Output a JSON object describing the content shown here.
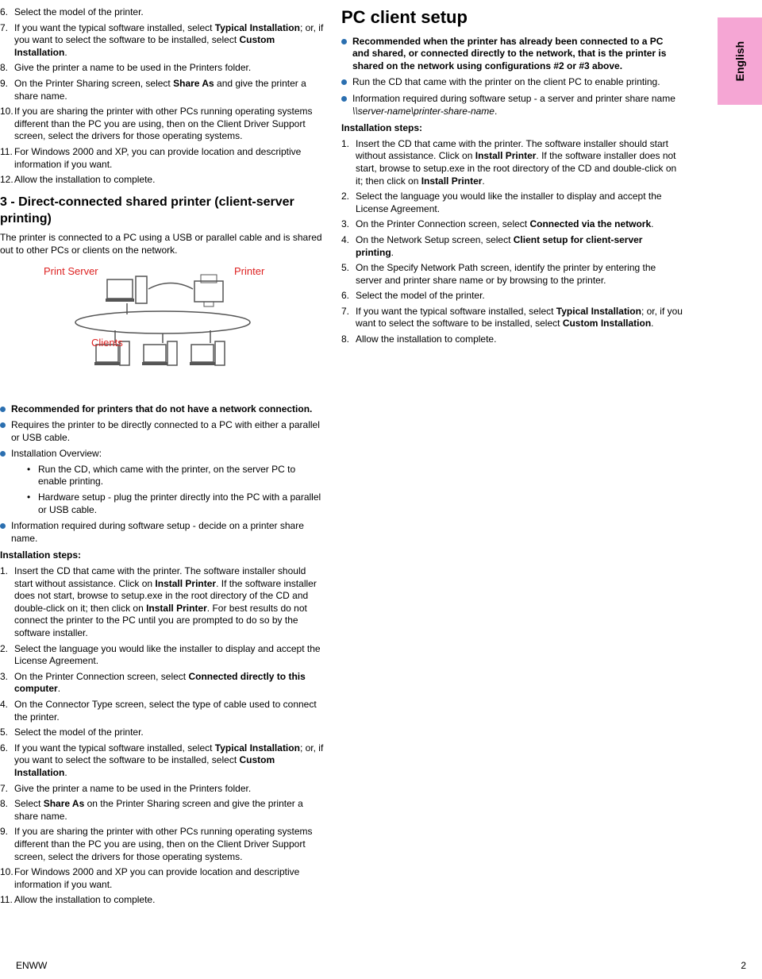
{
  "sideTab": "English",
  "leftTopList": {
    "start": 6,
    "items": [
      "Select the model of the printer.",
      "If you want the typical software installed, select <b>Typical Installation</b>; or, if you want to select the software to be installed, select <b>Custom Installation</b>.",
      "Give the printer a name to be used in the Printers folder.",
      "On the Printer Sharing screen, select <b>Share As</b> and give the printer a share name.",
      "If you are sharing the printer with other PCs running operating systems different than the PC you are using, then on the Client Driver Support screen, select the drivers for those operating systems.",
      "For Windows 2000 and XP, you can provide location and descriptive information if you want.",
      "Allow the installation to complete."
    ]
  },
  "section3": {
    "heading": "3 - Direct-connected shared printer (client-server printing)",
    "intro": "The printer is connected to a PC using a USB or parallel cable and is shared out to other PCs or clients on the network.",
    "diagram": {
      "printServer": "Print Server",
      "printer": "Printer",
      "clients": "Clients"
    },
    "bullets": [
      "<b>Recommended for printers that do not have a network connection.</b>",
      "Requires the printer to be directly connected to a PC with either a parallel or USB cable.",
      "Installation Overview:",
      "Information required during software setup - decide on a printer share name."
    ],
    "overviewSub": [
      "Run the CD, which came with the printer, on the server PC to enable printing.",
      "Hardware setup - plug the printer directly into the PC with a parallel or USB cable."
    ],
    "installLabel": "Installation steps:",
    "installSteps": [
      "Insert the CD that came with the printer. The software installer should start without assistance. Click on <b>Install Printer</b>. If the software installer does not start, browse to setup.exe in the root directory of the CD and double-click on it; then click on <b>Install Printer</b>. For best results do not connect the printer to the PC until you are prompted to do so by the software installer.",
      "Select the language you would like the installer to display and accept the License Agreement.",
      "On the Printer Connection screen, select <b>Connected directly to this computer</b>.",
      "On the Connector Type screen, select the type of cable used to connect the printer.",
      "Select the model of the printer.",
      "If you want the typical software installed, select <b>Typical Installation</b>; or, if you want to select the software to be installed, select <b>Custom Installation</b>.",
      "Give the printer a name to be used in the Printers folder.",
      "Select <b>Share As</b> on the Printer Sharing screen and give the printer a share name.",
      "If you are sharing the printer with other PCs running operating systems different than the PC you are using, then on the Client Driver Support screen, select the drivers for those operating systems.",
      "For Windows 2000 and XP you can provide location and descriptive information if you want.",
      "Allow the installation to complete."
    ]
  },
  "right": {
    "heading": "PC client setup",
    "bullets": [
      "<b>Recommended when the printer has already been connected to a PC and shared, or connected directly to the network, that is the printer is shared on the network using configurations #2 or #3 above.</b>",
      "Run the CD that came with the printer on the client PC to enable printing.",
      "Information required during software setup - a server and printer share name <i>\\\\server-name\\printer-share-name</i>."
    ],
    "installLabel": "Installation steps:",
    "installSteps": [
      "Insert the CD that came with the printer. The software installer should start without assistance. Click on <b>Install Printer</b>. If the software installer does not start, browse to setup.exe in the root directory of the CD and double-click on it; then click on <b>Install Printer</b>.",
      "Select the language you would like the installer to display and accept the License Agreement.",
      "On the Printer Connection screen, select <b>Connected via the network</b>.",
      "On the Network Setup screen, select <b>Client setup for client-server printing</b>.",
      "On the Specify Network Path screen, identify the printer by entering the server and printer share name or by browsing to the printer.",
      "Select the model of the printer.",
      "If you want the typical software installed, select <b>Typical Installation</b>; or, if you want to select the software to be installed, select <b>Custom Installation</b>.",
      "Allow the installation to complete."
    ]
  },
  "footer": {
    "left": "ENWW",
    "right": "2"
  }
}
